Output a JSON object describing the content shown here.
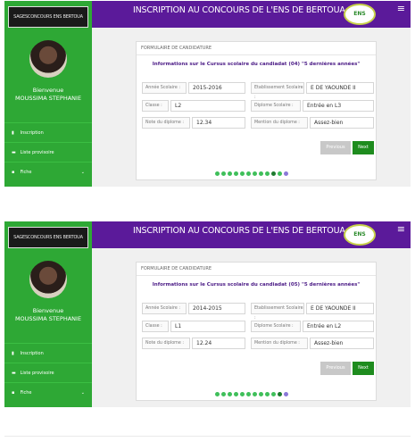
{
  "app": {
    "logo_text": "SAGESCONCOURS ENS BERTOUA",
    "title": "INSCRIPTION AU CONCOURS DE L'ENS DE BERTOUA",
    "emblem_text": "ENS",
    "menu_icon": "hamburger-icon"
  },
  "user": {
    "welcome": "Bienvenue",
    "name": "MOUSSIMA STEPHANIE"
  },
  "sidebar": {
    "items": [
      {
        "label": "Inscription",
        "icon": "chart-icon"
      },
      {
        "label": "Liste provisoire",
        "icon": "car-icon"
      },
      {
        "label": "Fiche",
        "icon": "file-icon",
        "has_chevron": true
      }
    ]
  },
  "form": {
    "card_header": "FORMULAIRE DE CANDIDATURE",
    "labels": {
      "annee": "Année Scolaire :",
      "etablissement": "Etablissement Scolaire :",
      "classe": "Classe :",
      "diplome": "Diplome Scolaire :",
      "note": "Note du diplome :",
      "mention": "Mention du diplome :"
    },
    "buttons": {
      "previous": "Previous",
      "next": "Next"
    }
  },
  "screens": [
    {
      "title": "Informations sur le Cursus scolaire du candiadat (04) \"5 dernières années\"",
      "annee": "2015-2016",
      "etablissement": "E DE YAOUNDE II",
      "classe": "L2",
      "diplome": "Entrée en L3",
      "note": "12.34",
      "mention": "Assez-bien",
      "active_dot": 9
    },
    {
      "title": "Informations sur le Cursus scolaire du candiadat (05) \"5 dernières années\"",
      "annee": "2014-2015",
      "etablissement": "E DE YAOUNDE II",
      "classe": "L1",
      "diplome": "Entrée en L2",
      "note": "12.24",
      "mention": "Assez-bien",
      "active_dot": 10
    }
  ]
}
